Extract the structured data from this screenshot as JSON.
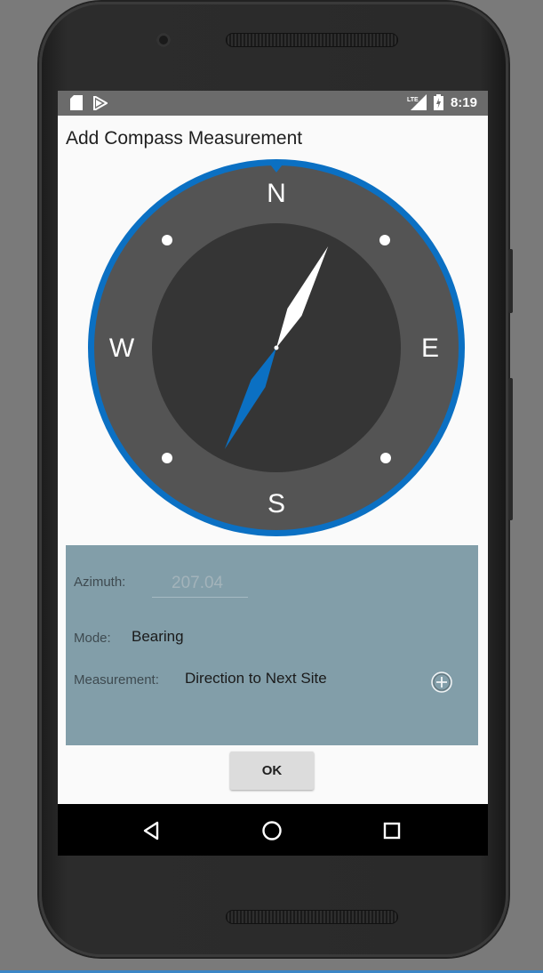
{
  "statusbar": {
    "time": "8:19",
    "network": "LTE",
    "icons": [
      "sd-card-icon",
      "play-store-icon",
      "signal-icon",
      "battery-charging-icon"
    ]
  },
  "dialog": {
    "title": "Add Compass Measurement"
  },
  "compass": {
    "labels": {
      "north": "N",
      "east": "E",
      "south": "S",
      "west": "W"
    },
    "azimuth_value": 207.04,
    "colors": {
      "ring": "#0b70c3",
      "bezel": "#545454",
      "face": "#353535",
      "needle_north": "#ffffff",
      "needle_south": "#0b70c3"
    }
  },
  "form": {
    "azimuth_label": "Azimuth:",
    "azimuth_value": "207.04",
    "mode_label": "Mode:",
    "mode_value": "Bearing",
    "measurement_label": "Measurement:",
    "measurement_value": "Direction to Next Site",
    "panel_color": "#829ea9"
  },
  "actions": {
    "ok_label": "OK"
  },
  "navbar": {
    "buttons": [
      "back-icon",
      "home-icon",
      "recents-icon"
    ]
  }
}
